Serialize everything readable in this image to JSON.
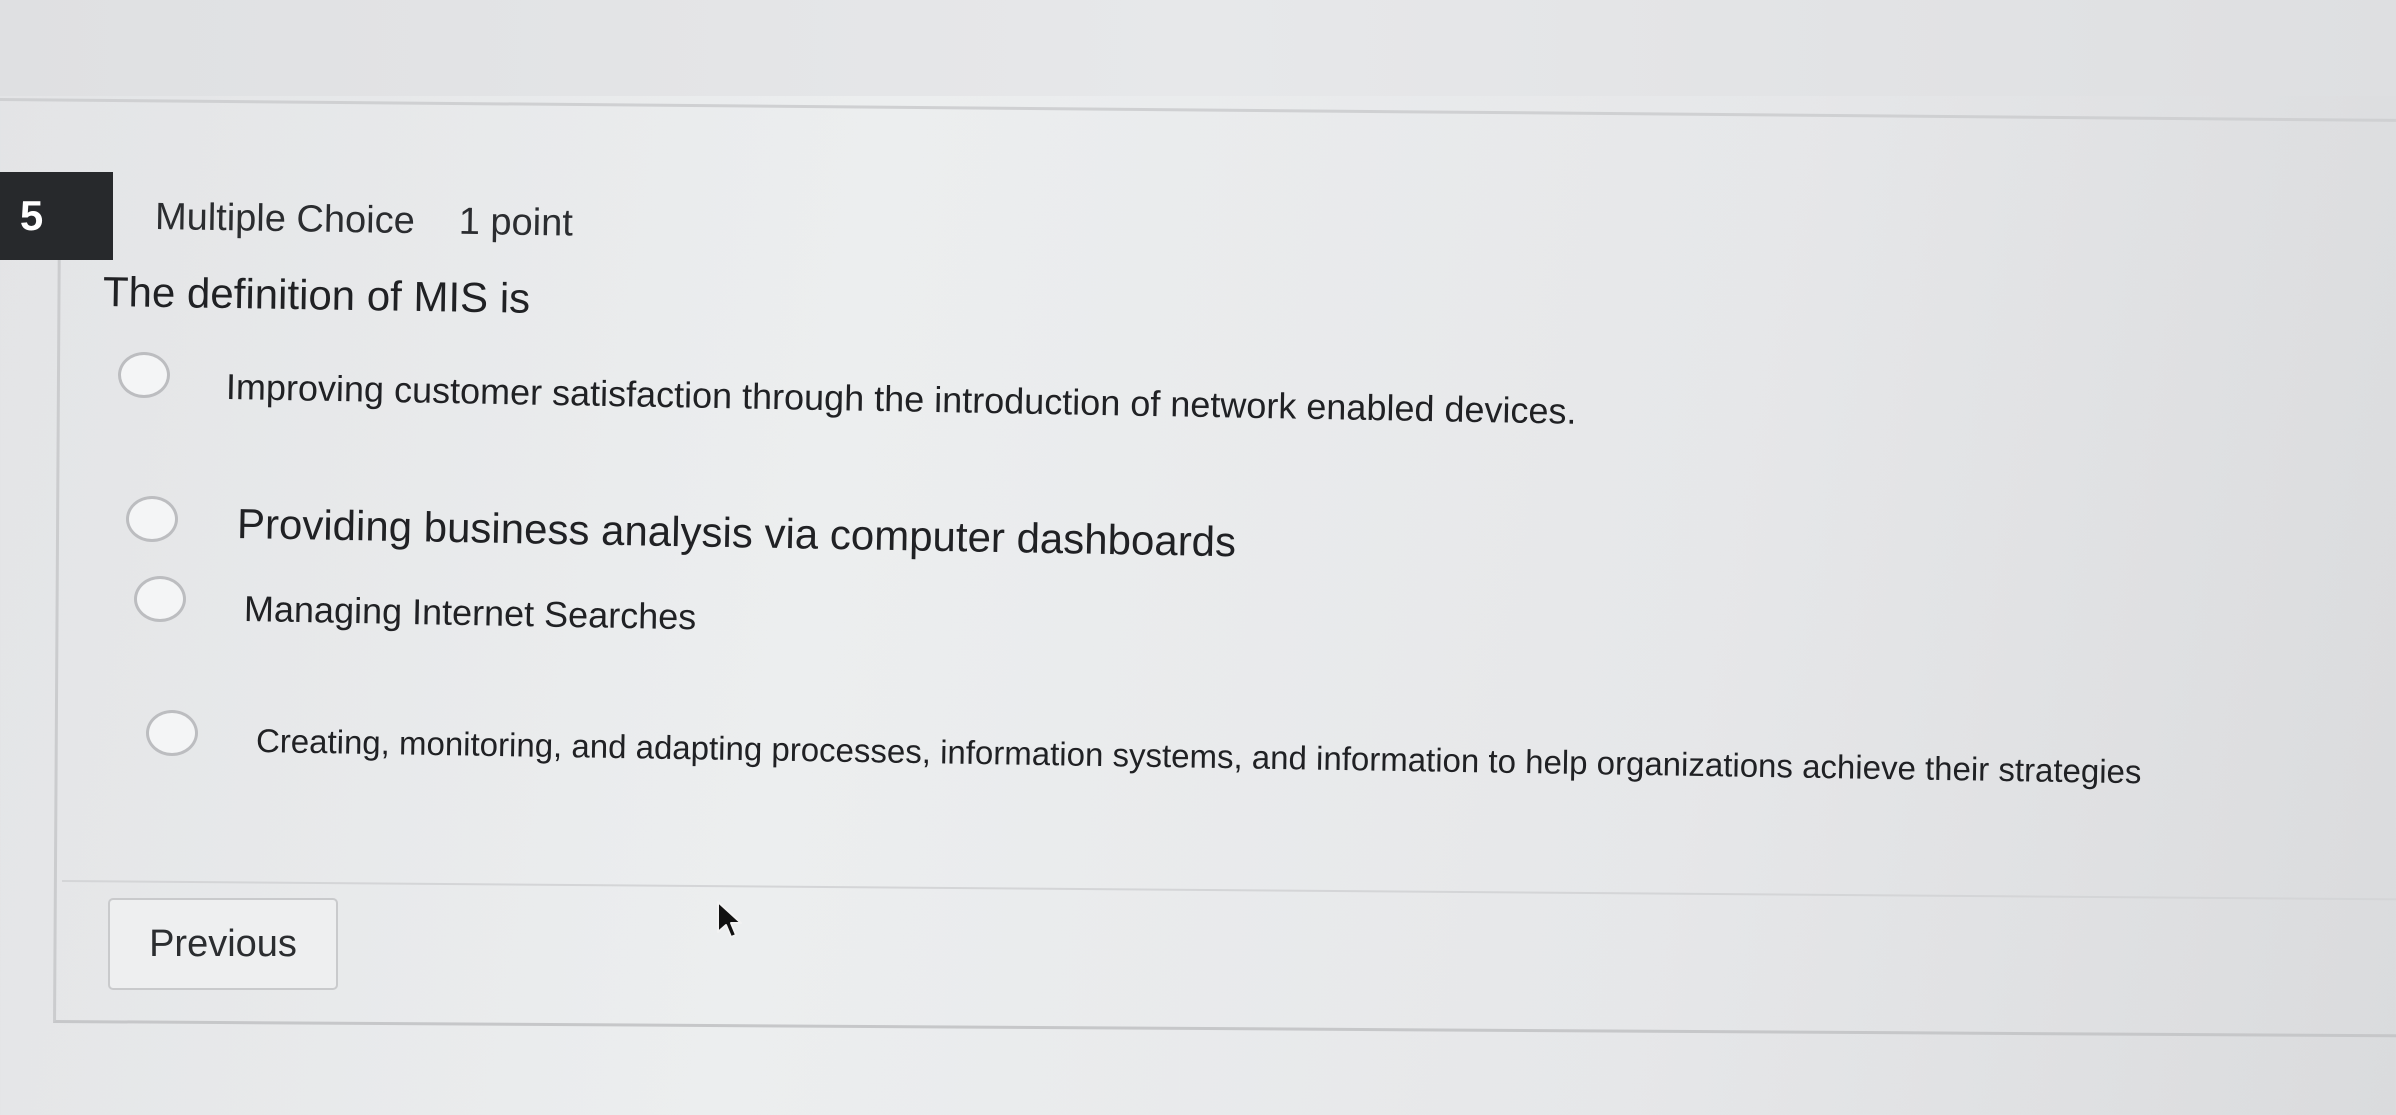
{
  "question": {
    "number": "5",
    "type": "Multiple Choice",
    "points": "1 point",
    "prompt": "The definition of MIS is",
    "options": [
      {
        "label": "Improving customer satisfaction through the introduction of network enabled devices.",
        "selected": false
      },
      {
        "label": "Providing business analysis via computer dashboards",
        "selected": false
      },
      {
        "label": "Managing Internet Searches",
        "selected": false
      },
      {
        "label": "Creating, monitoring, and adapting processes, information systems, and information to help organizations achieve their strategies",
        "selected": false
      }
    ]
  },
  "navigation": {
    "previous_label": "Previous"
  },
  "icons": {
    "cursor": "mouse-pointer-icon",
    "radio": "radio-button-unchecked"
  },
  "colors": {
    "question_badge": "#27292c",
    "badge_text": "#ffffff",
    "text": "#202124",
    "border": "#c9cacc"
  }
}
